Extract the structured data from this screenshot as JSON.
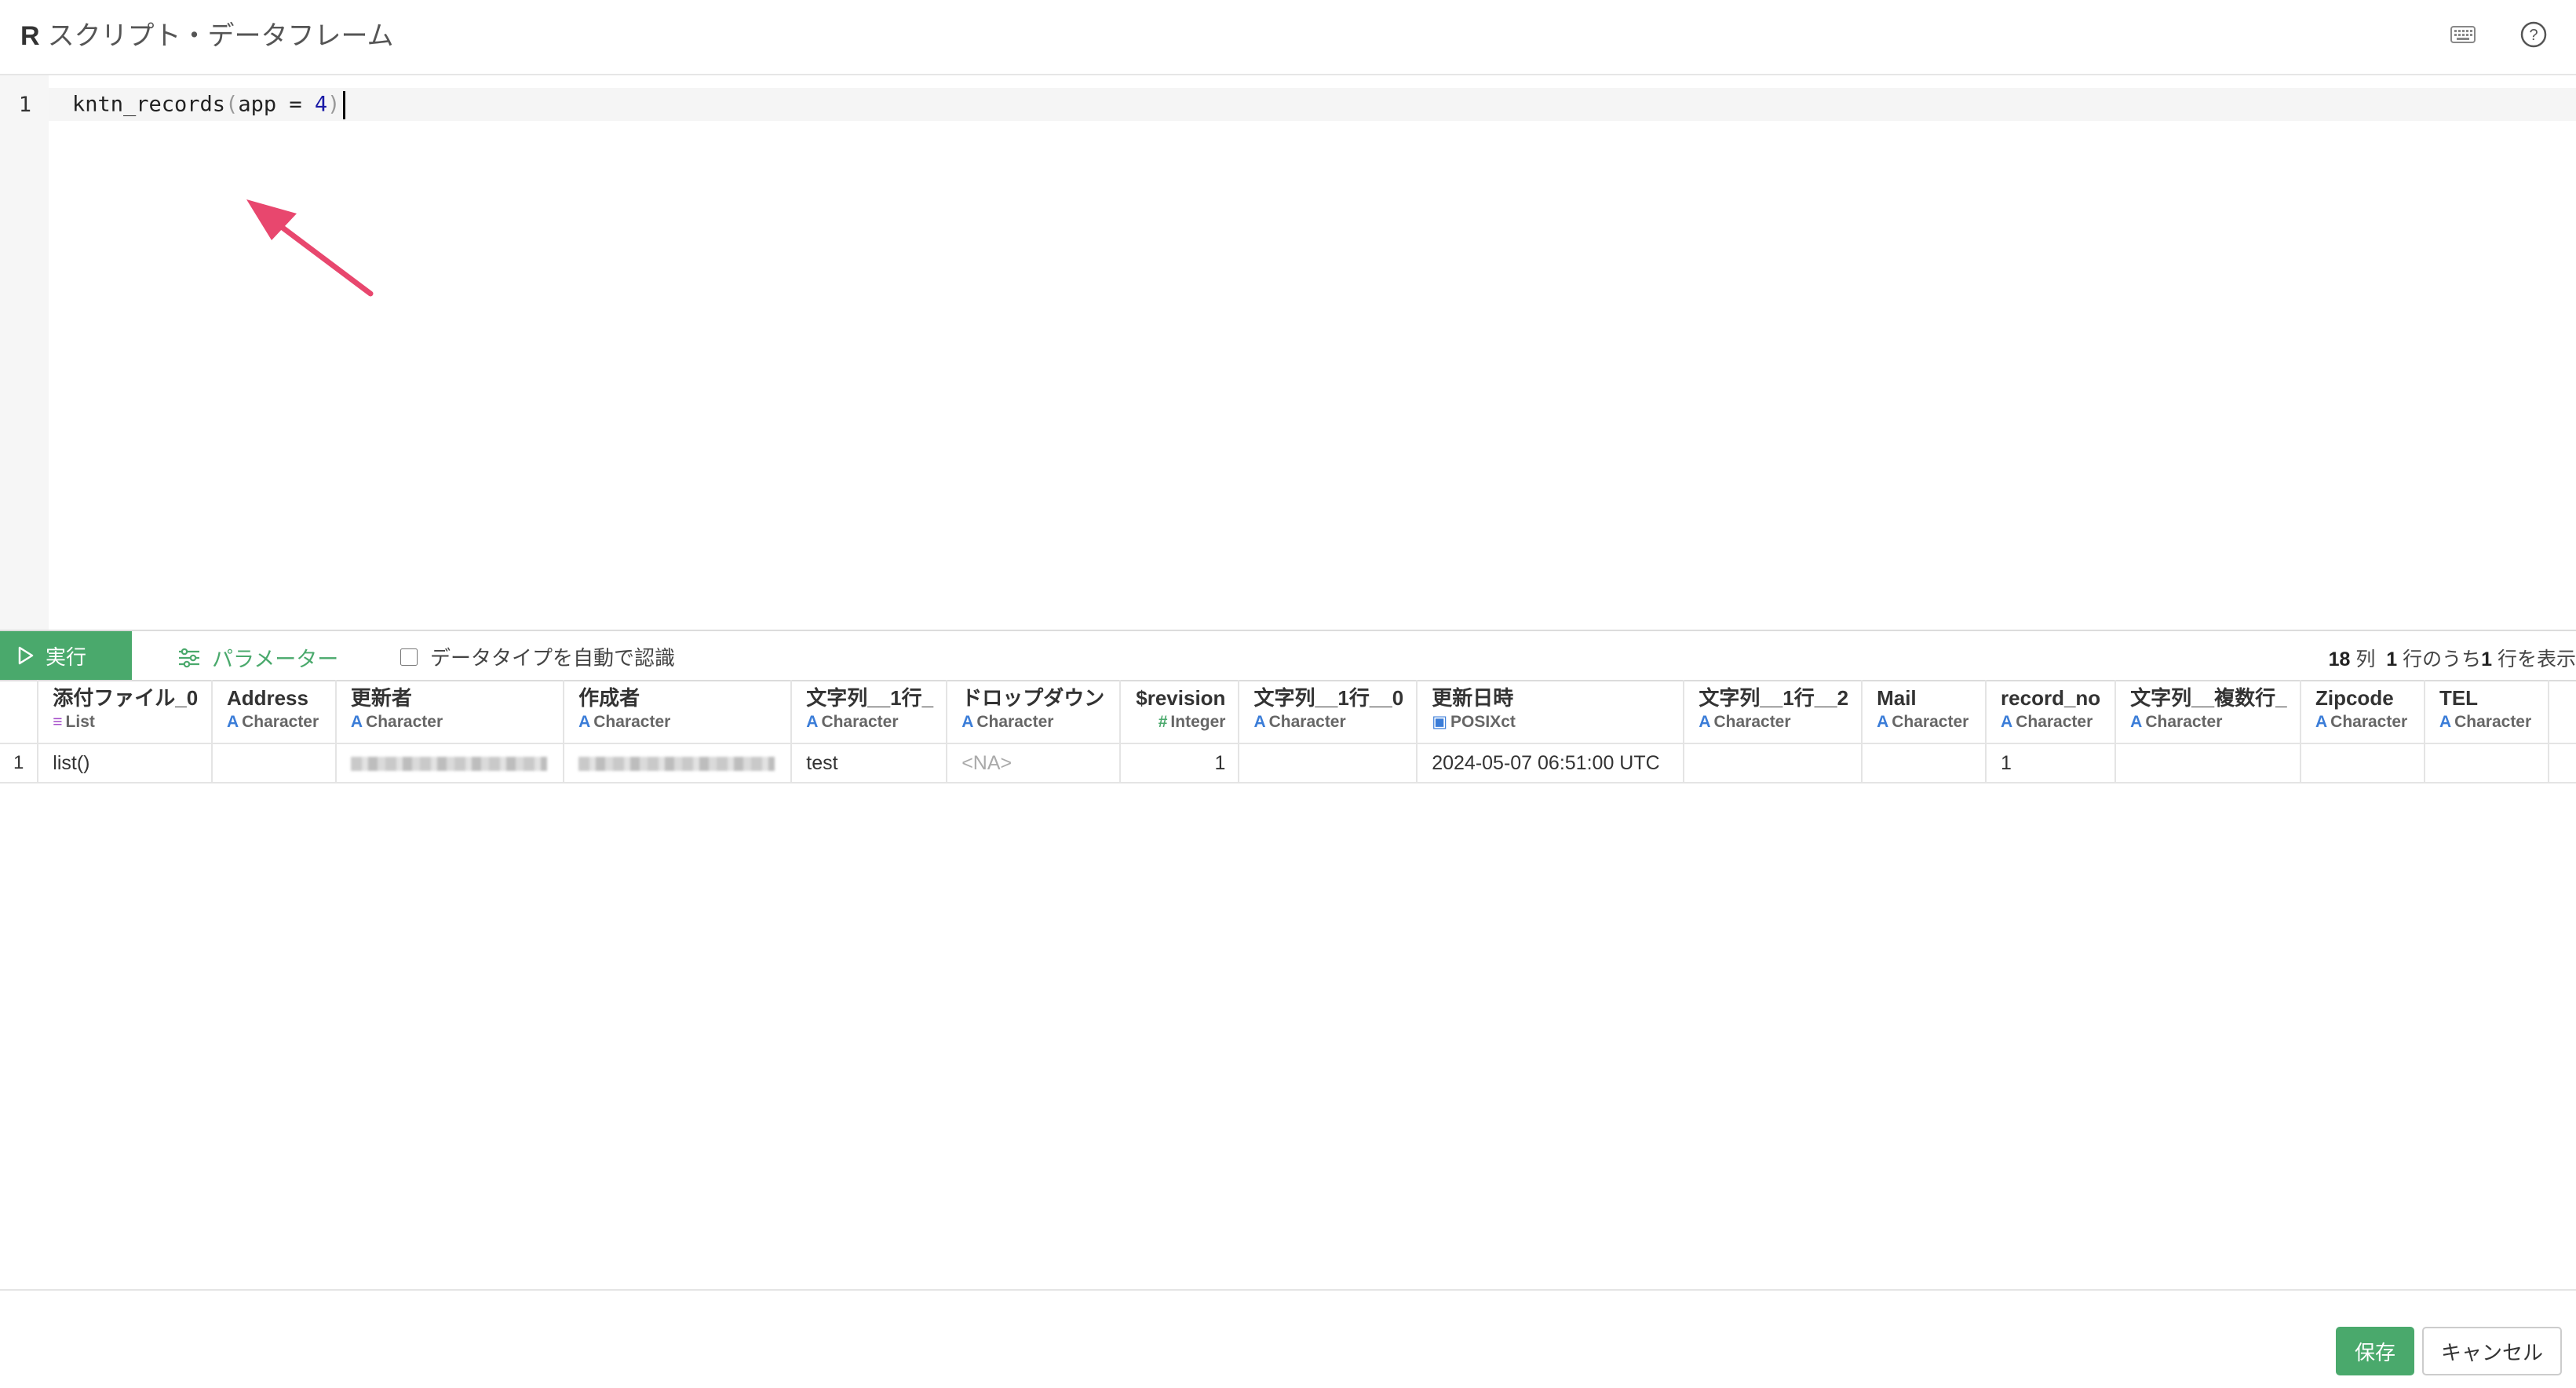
{
  "app": {
    "title_prefix": "R",
    "title": "スクリプト・データフレーム",
    "icons": {
      "keyboard": "keyboard-icon",
      "help": "help-circle-icon"
    }
  },
  "editor": {
    "line_number": "1",
    "code": {
      "function": "kntn_records",
      "open_paren": "(",
      "arg": "app = ",
      "value": "4",
      "close_paren": ")"
    }
  },
  "annotation": {
    "color": "#e8476e",
    "icon": "arrow-annotation"
  },
  "toolbar": {
    "run_label": "実行",
    "parameter_label": "パラメーター",
    "auto_type_label": "データタイプを自動で認識",
    "auto_type_checked": false,
    "summary": {
      "col_count": "18",
      "col_unit": "列",
      "row_total": "1",
      "row_mid": "行のうち",
      "row_shown": "1",
      "row_suffix": "行を表示"
    }
  },
  "table": {
    "columns": [
      {
        "name": "添付ファイル_0",
        "type": "List",
        "icon": "list-icon"
      },
      {
        "name": "Address",
        "type": "Character",
        "icon": "character-icon"
      },
      {
        "name": "更新者",
        "type": "Character",
        "icon": "character-icon"
      },
      {
        "name": "作成者",
        "type": "Character",
        "icon": "character-icon"
      },
      {
        "name": "文字列__1行_",
        "type": "Character",
        "icon": "character-icon"
      },
      {
        "name": "ドロップダウン",
        "type": "Character",
        "icon": "character-icon"
      },
      {
        "name": "$revision",
        "type": "Integer",
        "icon": "integer-icon"
      },
      {
        "name": "文字列__1行__0",
        "type": "Character",
        "icon": "character-icon"
      },
      {
        "name": "更新日時",
        "type": "POSIXct",
        "icon": "calendar-icon"
      },
      {
        "name": "文字列__1行__2",
        "type": "Character",
        "icon": "character-icon"
      },
      {
        "name": "Mail",
        "type": "Character",
        "icon": "character-icon"
      },
      {
        "name": "record_no",
        "type": "Character",
        "icon": "character-icon"
      },
      {
        "name": "文字列__複数行_",
        "type": "Character",
        "icon": "character-icon"
      },
      {
        "name": "Zipcode",
        "type": "Character",
        "icon": "character-icon"
      },
      {
        "name": "TEL",
        "type": "Character",
        "icon": "character-icon"
      }
    ],
    "rows": [
      {
        "num": "1",
        "cells": [
          "list()",
          "",
          "",
          "",
          "test",
          "<NA>",
          "1",
          "",
          "2024-05-07 06:51:00 UTC",
          "",
          "",
          "1",
          "",
          "",
          ""
        ]
      }
    ]
  },
  "footer": {
    "save_label": "保存",
    "cancel_label": "キャンセル"
  },
  "colors": {
    "accent": "#4aa96c",
    "character_type": "#3b7dd8",
    "list_type": "#a44bc9"
  }
}
